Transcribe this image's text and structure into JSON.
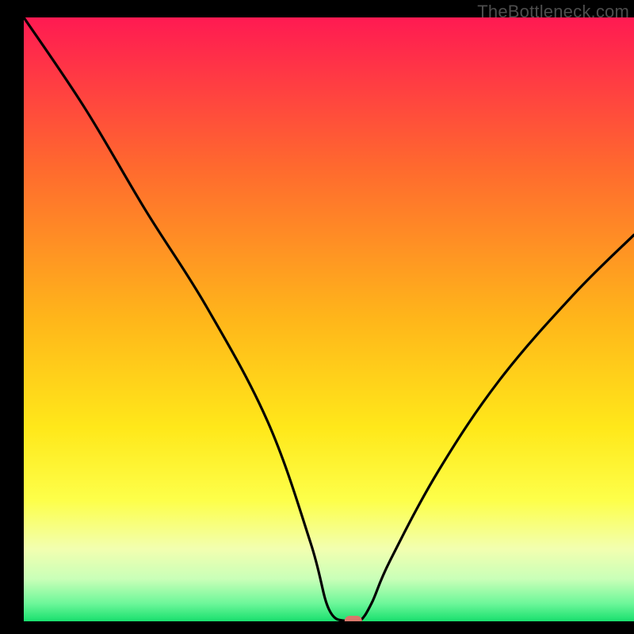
{
  "watermark": "TheBottleneck.com",
  "chart_data": {
    "type": "line",
    "title": "",
    "xlabel": "",
    "ylabel": "",
    "xlim": [
      0,
      100
    ],
    "ylim": [
      0,
      100
    ],
    "grid": false,
    "legend": false,
    "series": [
      {
        "name": "bottleneck-curve",
        "x": [
          0,
          10,
          20,
          30,
          40,
          47,
          50,
          53,
          55,
          57,
          60,
          68,
          78,
          90,
          100
        ],
        "values": [
          100,
          85,
          68,
          52,
          33,
          13,
          2,
          0,
          0,
          3,
          10,
          25,
          40,
          54,
          64
        ]
      }
    ],
    "marker": {
      "name": "optimal-point",
      "x": 54,
      "y": 0,
      "color": "#d9776b"
    },
    "background_gradient": {
      "stops": [
        {
          "offset": 0.0,
          "color": "#ff1a52"
        },
        {
          "offset": 0.25,
          "color": "#ff6a2e"
        },
        {
          "offset": 0.5,
          "color": "#ffb61a"
        },
        {
          "offset": 0.68,
          "color": "#ffe81a"
        },
        {
          "offset": 0.8,
          "color": "#fdff4a"
        },
        {
          "offset": 0.88,
          "color": "#f2ffb0"
        },
        {
          "offset": 0.93,
          "color": "#c9ffb8"
        },
        {
          "offset": 0.97,
          "color": "#6ef79a"
        },
        {
          "offset": 1.0,
          "color": "#19e06e"
        }
      ]
    }
  }
}
